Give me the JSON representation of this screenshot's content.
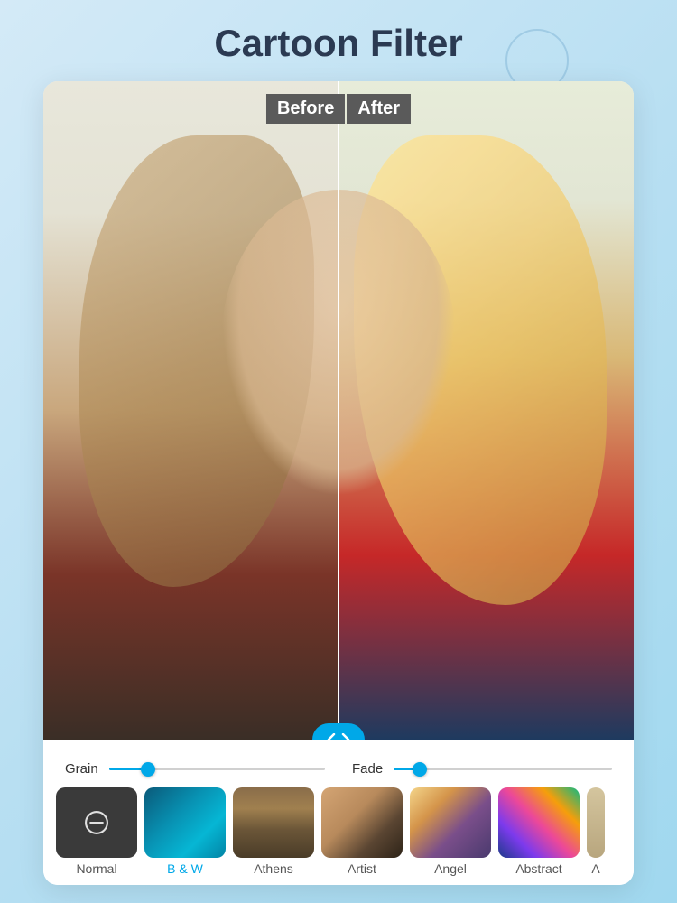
{
  "header": {
    "title": "Cartoon Filter"
  },
  "comparison": {
    "before_label": "Before",
    "after_label": "After"
  },
  "sliders": {
    "grain": {
      "label": "Grain",
      "value_pct": 18
    },
    "fade": {
      "label": "Fade",
      "value_pct": 12
    }
  },
  "filters": [
    {
      "label": "Normal",
      "active": false,
      "icon": "minus-circle"
    },
    {
      "label": "B & W",
      "active": true
    },
    {
      "label": "Athens",
      "active": false
    },
    {
      "label": "Artist",
      "active": false
    },
    {
      "label": "Angel",
      "active": false
    },
    {
      "label": "Abstract",
      "active": false
    },
    {
      "label": "A",
      "active": false,
      "partial": true
    }
  ],
  "colors": {
    "accent": "#00a8e8",
    "title": "#2b3a52"
  }
}
